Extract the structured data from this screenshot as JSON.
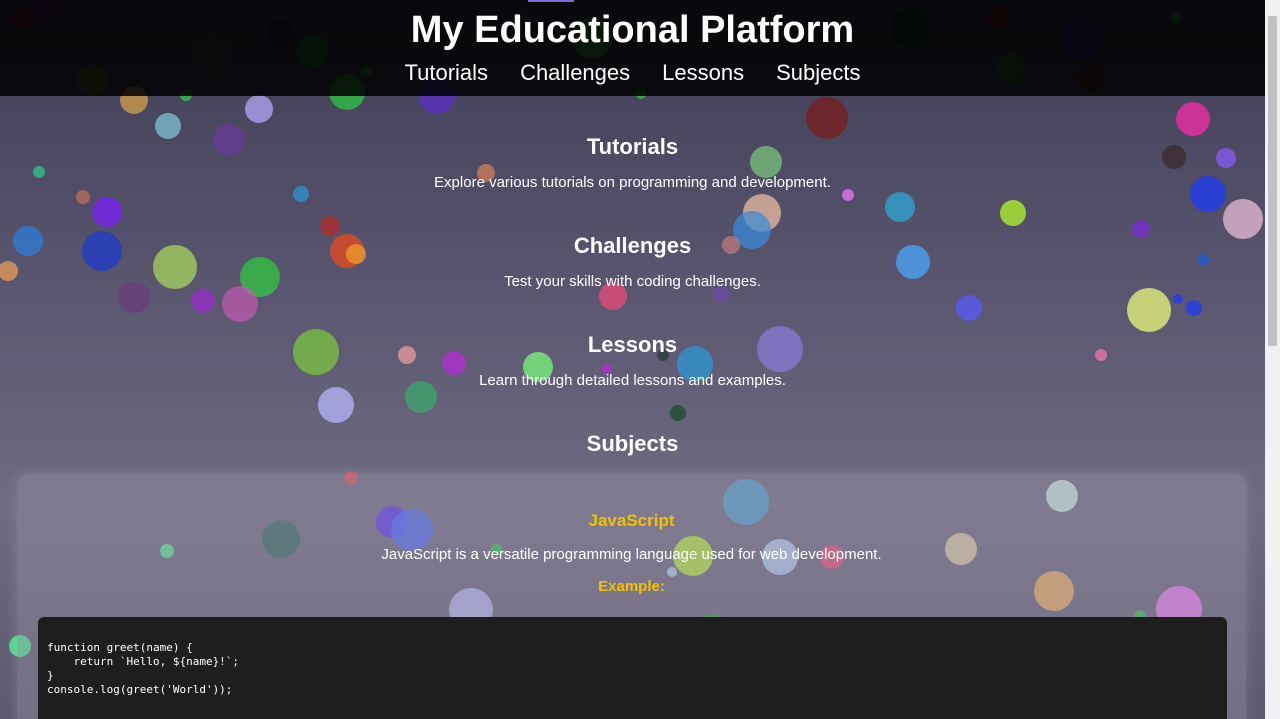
{
  "header": {
    "title": "My Educational Platform",
    "nav": [
      "Tutorials",
      "Challenges",
      "Lessons",
      "Subjects"
    ]
  },
  "sections": [
    {
      "heading": "Tutorials",
      "text": "Explore various tutorials on programming and development."
    },
    {
      "heading": "Challenges",
      "text": "Test your skills with coding challenges."
    },
    {
      "heading": "Lessons",
      "text": "Learn through detailed lessons and examples."
    },
    {
      "heading": "Subjects"
    }
  ],
  "subject": {
    "name": "JavaScript",
    "description": "JavaScript is a versatile programming language used for web development.",
    "example_label": "Example:",
    "code": "function greet(name) {\n    return `Hello, ${name}!`;\n}\nconsole.log(greet('World'));"
  },
  "colors": {
    "accent": "#f2c200",
    "header_bg": "#000000",
    "code_bg": "#1e1e1e"
  }
}
